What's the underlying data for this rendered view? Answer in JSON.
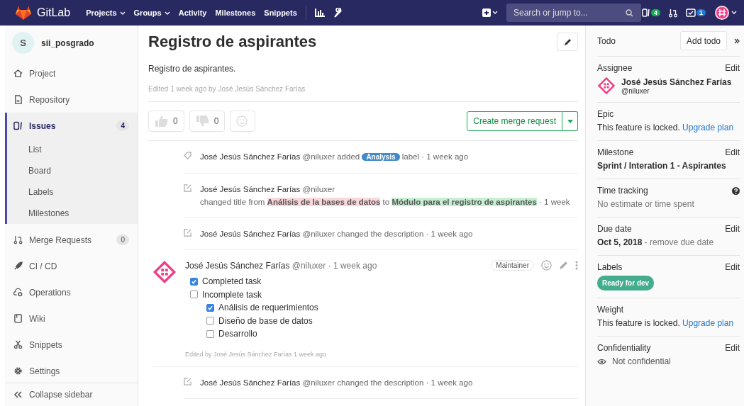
{
  "nav": {
    "brand": "GitLab",
    "links": [
      {
        "label": "Projects",
        "dropdown": true
      },
      {
        "label": "Groups",
        "dropdown": true
      },
      {
        "label": "Activity",
        "dropdown": false
      },
      {
        "label": "Milestones",
        "dropdown": false
      },
      {
        "label": "Snippets",
        "dropdown": false
      }
    ],
    "search": {
      "placeholder": "Search or jump to..."
    },
    "issues_count": "4",
    "todos_count": "1"
  },
  "sidebar": {
    "project": {
      "initial": "S",
      "name": "sii_posgrado"
    },
    "items": [
      {
        "label": "Project",
        "selected": false
      },
      {
        "label": "Repository",
        "selected": false
      },
      {
        "label": "Issues",
        "count": "4",
        "selected": true,
        "children": [
          {
            "label": "List"
          },
          {
            "label": "Board"
          },
          {
            "label": "Labels"
          },
          {
            "label": "Milestones"
          }
        ]
      },
      {
        "label": "Merge Requests",
        "count": "0",
        "selected": false
      },
      {
        "label": "CI / CD",
        "selected": false
      },
      {
        "label": "Operations",
        "selected": false
      },
      {
        "label": "Wiki",
        "selected": false
      },
      {
        "label": "Snippets",
        "selected": false
      },
      {
        "label": "Settings",
        "selected": false
      }
    ],
    "collapse": "Collapse sidebar"
  },
  "issue": {
    "title": "Registro de aspirantes",
    "description": "Registro de aspirantes.",
    "edited": "Edited 1 week ago by José Jesús Sánchez Farías",
    "awards": [
      {
        "kind": "up",
        "count": "0"
      },
      {
        "kind": "down",
        "count": "0"
      }
    ],
    "create_mr": "Create merge request"
  },
  "notes": [
    {
      "kind": "label",
      "author": "José Jesús Sánchez Farías",
      "handle": "@niluxer",
      "text": "added",
      "label": {
        "text": "Analysis",
        "color": "#428bca"
      },
      "after": "label · 1 week ago"
    },
    {
      "kind": "title",
      "author": "José Jesús Sánchez Farías",
      "handle": "@niluxer",
      "text": "changed title from",
      "old": "Análisis de la bases de datos",
      "mid": "to",
      "new": "Módulo para el registro de aspirantes",
      "after": "· 1 week"
    },
    {
      "kind": "description",
      "author": "José Jesús Sánchez Farías",
      "handle": "@niluxer",
      "text": "changed the description · 1 week ago"
    },
    {
      "kind": "comment",
      "author": "José Jesús Sánchez Farías",
      "handle": "@niluxer",
      "time": "· 1 week ago",
      "role": "Maintainer",
      "tasks": [
        {
          "label": "Completed task",
          "checked": true
        },
        {
          "label": "Incomplete task",
          "checked": false,
          "children": [
            {
              "label": "Análisis de requerimientos",
              "checked": true
            },
            {
              "label": "Diseño de base de datos",
              "checked": false
            },
            {
              "label": "Desarrollo",
              "checked": false
            }
          ]
        }
      ],
      "edited": "Edited by José Jesús Sánchez Farías 1 week ago"
    },
    {
      "kind": "description",
      "author": "José Jesús Sánchez Farías",
      "handle": "@niluxer",
      "text": "changed the description · 1 week ago"
    }
  ],
  "right": {
    "todo": {
      "label": "Todo",
      "button": "Add todo"
    },
    "sections": [
      {
        "kind": "user",
        "title": "Assignee",
        "action": "Edit",
        "name": "José Jesús Sánchez Farías",
        "handle": "@niluxer"
      },
      {
        "kind": "locked",
        "title": "Epic",
        "text": "This feature is locked.",
        "link": "Upgrade plan"
      },
      {
        "kind": "bold",
        "title": "Milestone",
        "action": "Edit",
        "value": "Sprint / Interation 1 - Aspirantes"
      },
      {
        "kind": "help",
        "title": "Time tracking",
        "value": "No estimate or time spent"
      },
      {
        "kind": "date",
        "title": "Due date",
        "action": "Edit",
        "value": "Oct 5, 2018",
        "extra": "- remove due date"
      },
      {
        "kind": "labels",
        "title": "Labels",
        "action": "Edit",
        "labels": [
          {
            "text": "Ready for dev",
            "color": "#44ad8e"
          }
        ]
      },
      {
        "kind": "locked",
        "title": "Weight",
        "text": "This feature is locked.",
        "link": "Upgrade plan"
      },
      {
        "kind": "eye",
        "title": "Confidentiality",
        "action": "Edit",
        "value": "Not confidential"
      }
    ]
  }
}
